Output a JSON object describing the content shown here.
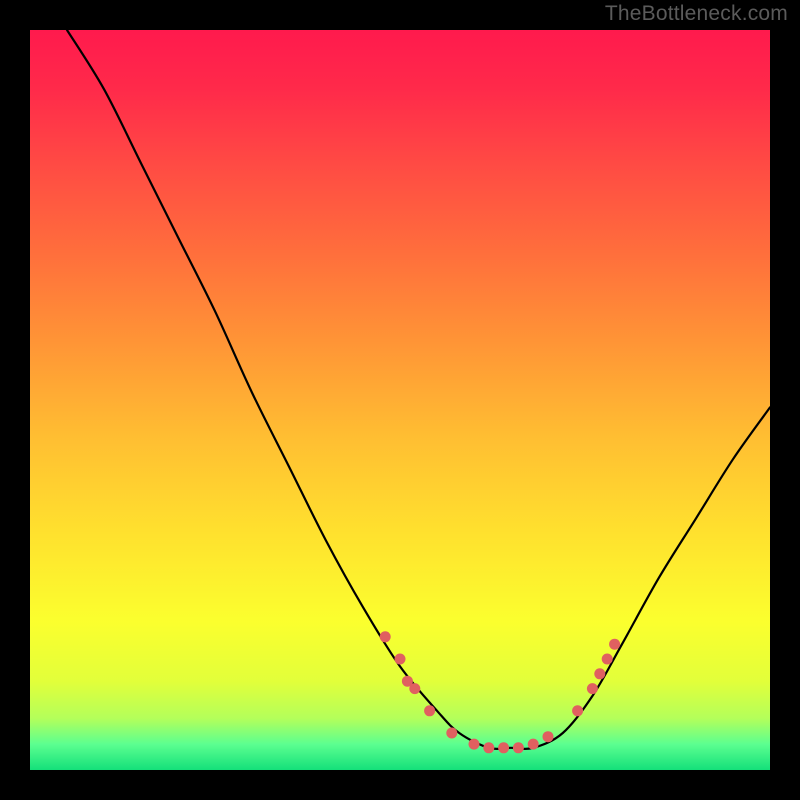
{
  "watermark": "TheBottleneck.com",
  "chart_data": {
    "type": "line",
    "title": "",
    "xlabel": "",
    "ylabel": "",
    "xlim": [
      0,
      100
    ],
    "ylim": [
      0,
      100
    ],
    "grid": false,
    "legend": false,
    "curve": [
      {
        "x": 5,
        "y": 100
      },
      {
        "x": 10,
        "y": 92
      },
      {
        "x": 15,
        "y": 82
      },
      {
        "x": 20,
        "y": 72
      },
      {
        "x": 25,
        "y": 62
      },
      {
        "x": 30,
        "y": 51
      },
      {
        "x": 35,
        "y": 41
      },
      {
        "x": 40,
        "y": 31
      },
      {
        "x": 45,
        "y": 22
      },
      {
        "x": 50,
        "y": 14
      },
      {
        "x": 55,
        "y": 8
      },
      {
        "x": 58,
        "y": 5
      },
      {
        "x": 62,
        "y": 3
      },
      {
        "x": 65,
        "y": 3
      },
      {
        "x": 68,
        "y": 3
      },
      {
        "x": 72,
        "y": 5
      },
      {
        "x": 76,
        "y": 10
      },
      {
        "x": 80,
        "y": 17
      },
      {
        "x": 85,
        "y": 26
      },
      {
        "x": 90,
        "y": 34
      },
      {
        "x": 95,
        "y": 42
      },
      {
        "x": 100,
        "y": 49
      }
    ],
    "markers": [
      {
        "x": 48,
        "y": 18
      },
      {
        "x": 50,
        "y": 15
      },
      {
        "x": 51,
        "y": 12
      },
      {
        "x": 52,
        "y": 11
      },
      {
        "x": 54,
        "y": 8
      },
      {
        "x": 57,
        "y": 5
      },
      {
        "x": 60,
        "y": 3.5
      },
      {
        "x": 62,
        "y": 3
      },
      {
        "x": 64,
        "y": 3
      },
      {
        "x": 66,
        "y": 3
      },
      {
        "x": 68,
        "y": 3.5
      },
      {
        "x": 70,
        "y": 4.5
      },
      {
        "x": 74,
        "y": 8
      },
      {
        "x": 76,
        "y": 11
      },
      {
        "x": 77,
        "y": 13
      },
      {
        "x": 78,
        "y": 15
      },
      {
        "x": 79,
        "y": 17
      }
    ],
    "gradient_stops": [
      {
        "offset": 0.0,
        "color": "#ff1a4d"
      },
      {
        "offset": 0.08,
        "color": "#ff2a4a"
      },
      {
        "offset": 0.18,
        "color": "#ff4a44"
      },
      {
        "offset": 0.3,
        "color": "#ff6e3c"
      },
      {
        "offset": 0.42,
        "color": "#ff9436"
      },
      {
        "offset": 0.55,
        "color": "#ffbe32"
      },
      {
        "offset": 0.68,
        "color": "#ffe12e"
      },
      {
        "offset": 0.8,
        "color": "#fbff2e"
      },
      {
        "offset": 0.88,
        "color": "#e2ff3a"
      },
      {
        "offset": 0.93,
        "color": "#b4ff5a"
      },
      {
        "offset": 0.965,
        "color": "#5cff90"
      },
      {
        "offset": 1.0,
        "color": "#14e07a"
      }
    ],
    "marker_color": "#e06060",
    "curve_color": "#000000"
  }
}
